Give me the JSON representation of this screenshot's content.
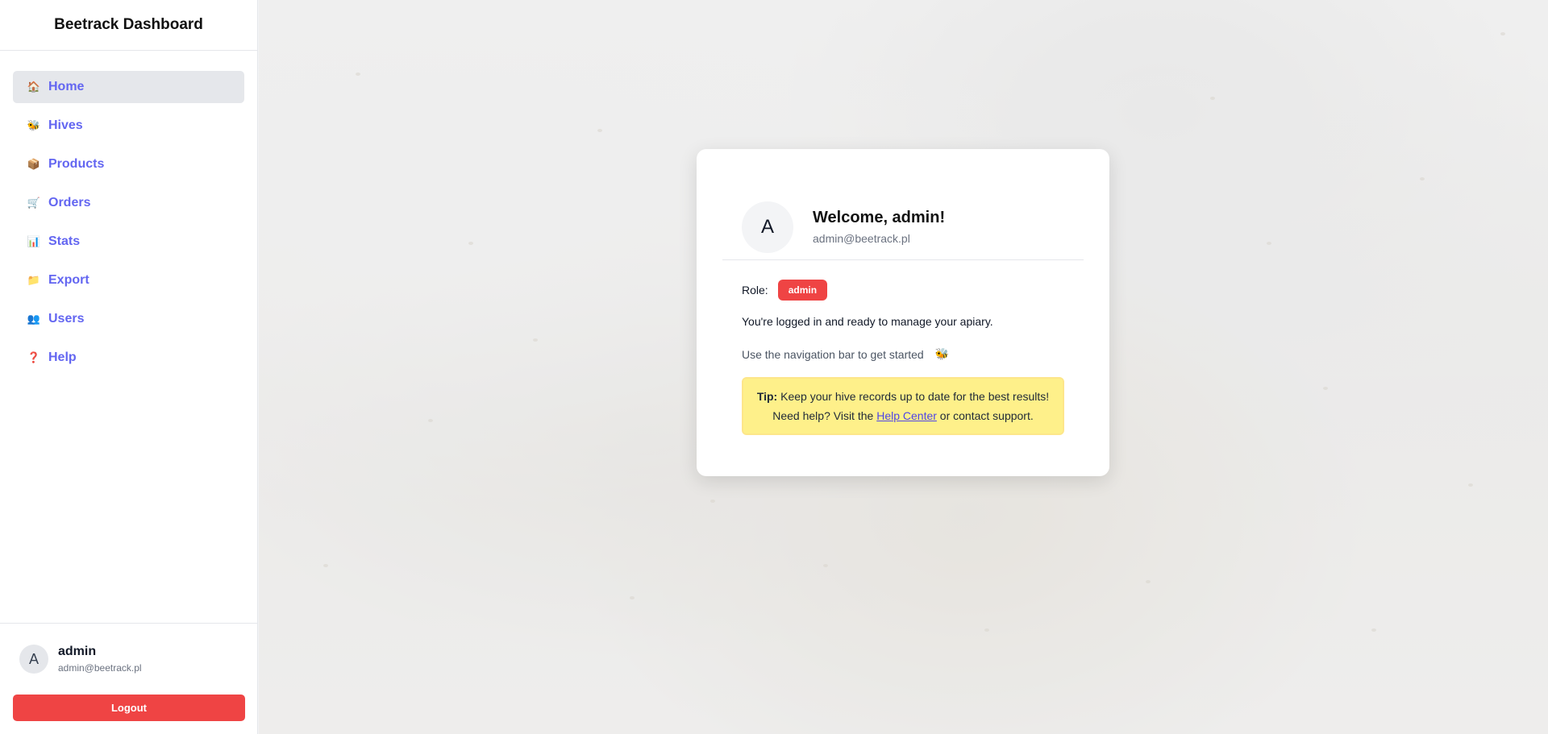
{
  "app": {
    "title": "Beetrack Dashboard"
  },
  "sidebar": {
    "items": [
      {
        "label": "Home",
        "icon": "🏠",
        "icon_name": "home-icon",
        "active": true
      },
      {
        "label": "Hives",
        "icon": "🐝",
        "icon_name": "bee-icon",
        "active": false
      },
      {
        "label": "Products",
        "icon": "📦",
        "icon_name": "package-icon",
        "active": false
      },
      {
        "label": "Orders",
        "icon": "🛒",
        "icon_name": "cart-icon",
        "active": false
      },
      {
        "label": "Stats",
        "icon": "📊",
        "icon_name": "chart-icon",
        "active": false
      },
      {
        "label": "Export",
        "icon": "📁",
        "icon_name": "folder-icon",
        "active": false
      },
      {
        "label": "Users",
        "icon": "👥",
        "icon_name": "users-icon",
        "active": false
      },
      {
        "label": "Help",
        "icon": "❓",
        "icon_name": "question-icon",
        "active": false
      }
    ],
    "user": {
      "initial": "A",
      "name": "admin",
      "email": "admin@beetrack.pl"
    },
    "logout_label": "Logout"
  },
  "card": {
    "avatar_initial": "A",
    "welcome": "Welcome, admin!",
    "email": "admin@beetrack.pl",
    "role_label": "Role:",
    "role_value": "admin",
    "ready_text": "You're logged in and ready to manage your apiary.",
    "hint_text": "Use the navigation bar to get started",
    "hint_icon": "🐝",
    "tip": {
      "label": "Tip:",
      "line1": "Keep your hive records up to date for the best results!",
      "line2_prefix": "Need help? Visit the",
      "link": "Help Center",
      "line2_suffix": "or contact support."
    }
  },
  "colors": {
    "accent": "#6366f1",
    "danger": "#ef4444",
    "tip_background": "#fef08a"
  }
}
